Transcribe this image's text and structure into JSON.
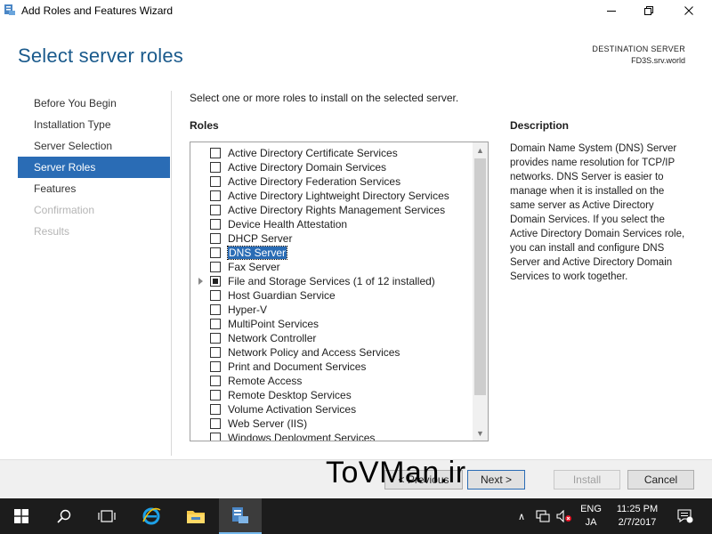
{
  "window": {
    "title": "Add Roles and Features Wizard",
    "minimize_glyph": "—",
    "maximize_glyph": "❐",
    "close_glyph": "✕"
  },
  "header": {
    "page_title": "Select server roles",
    "destination_label": "DESTINATION SERVER",
    "destination_value": "FD3S.srv.world"
  },
  "nav": {
    "items": [
      {
        "label": "Before You Begin",
        "state": "normal"
      },
      {
        "label": "Installation Type",
        "state": "normal"
      },
      {
        "label": "Server Selection",
        "state": "normal"
      },
      {
        "label": "Server Roles",
        "state": "active"
      },
      {
        "label": "Features",
        "state": "normal"
      },
      {
        "label": "Confirmation",
        "state": "disabled"
      },
      {
        "label": "Results",
        "state": "disabled"
      }
    ]
  },
  "content": {
    "intro": "Select one or more roles to install on the selected server.",
    "roles_heading": "Roles",
    "description_heading": "Description",
    "description_text": "Domain Name System (DNS) Server provides name resolution for TCP/IP networks. DNS Server is easier to manage when it is installed on the same server as Active Directory Domain Services. If you select the Active Directory Domain Services role, you can install and configure DNS Server and Active Directory Domain Services to work together.",
    "roles": [
      {
        "label": "Active Directory Certificate Services",
        "checked": false
      },
      {
        "label": "Active Directory Domain Services",
        "checked": false
      },
      {
        "label": "Active Directory Federation Services",
        "checked": false
      },
      {
        "label": "Active Directory Lightweight Directory Services",
        "checked": false
      },
      {
        "label": "Active Directory Rights Management Services",
        "checked": false
      },
      {
        "label": "Device Health Attestation",
        "checked": false
      },
      {
        "label": "DHCP Server",
        "checked": false
      },
      {
        "label": "DNS Server",
        "checked": false,
        "selected": true
      },
      {
        "label": "Fax Server",
        "checked": false
      },
      {
        "label": "File and Storage Services (1 of 12 installed)",
        "checked": "partial",
        "expandable": true
      },
      {
        "label": "Host Guardian Service",
        "checked": false
      },
      {
        "label": "Hyper-V",
        "checked": false
      },
      {
        "label": "MultiPoint Services",
        "checked": false
      },
      {
        "label": "Network Controller",
        "checked": false
      },
      {
        "label": "Network Policy and Access Services",
        "checked": false
      },
      {
        "label": "Print and Document Services",
        "checked": false
      },
      {
        "label": "Remote Access",
        "checked": false
      },
      {
        "label": "Remote Desktop Services",
        "checked": false
      },
      {
        "label": "Volume Activation Services",
        "checked": false
      },
      {
        "label": "Web Server (IIS)",
        "checked": false
      },
      {
        "label": "Windows Deployment Services",
        "checked": false
      }
    ],
    "scrollbar": {
      "up_glyph": "▲",
      "down_glyph": "▼"
    }
  },
  "buttons": {
    "previous": "< Previous",
    "next": "Next >",
    "install": "Install",
    "cancel": "Cancel"
  },
  "watermark": "ToVMan.ir",
  "taskbar": {
    "tray_chevron": "∧",
    "language_line1": "ENG",
    "language_line2": "JA",
    "time": "11:25 PM",
    "date": "2/7/2017"
  },
  "colors": {
    "accent": "#2a6cb5",
    "title_blue": "#1a5a8c",
    "taskbar": "#1c1c1c"
  }
}
